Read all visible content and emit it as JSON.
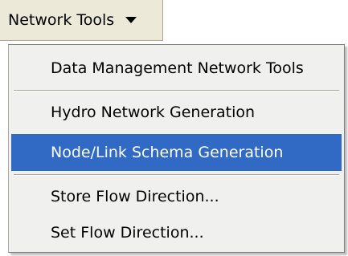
{
  "toolbar": {
    "menu_button_label": "Network Tools",
    "menu_button_icon": "chevron-down-icon"
  },
  "menu": {
    "items": [
      {
        "label": "Data Management Network Tools",
        "selected": false
      },
      {
        "label": "Hydro Network Generation",
        "selected": false
      },
      {
        "label": "Node/Link Schema Generation",
        "selected": true
      },
      {
        "label": "Store Flow Direction...",
        "selected": false
      },
      {
        "label": "Set Flow Direction...",
        "selected": false
      }
    ]
  },
  "colors": {
    "selection_background": "#316ac5",
    "selection_text": "#ffffff",
    "menu_background": "#f0f0ee",
    "toolbar_background": "#ece9d8"
  }
}
